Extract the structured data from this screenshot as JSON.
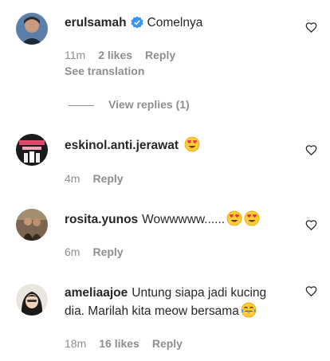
{
  "comments": [
    {
      "username": "erulsamah",
      "verified": true,
      "text": "Comelnya",
      "time": "11m",
      "likes": "2 likes",
      "reply_label": "Reply",
      "translation_label": "See translation",
      "view_replies_label": "View replies (1)"
    },
    {
      "username": "eskinol.anti.jerawat",
      "text": "",
      "emoji": "heart-eyes-emoji",
      "time": "4m",
      "reply_label": "Reply"
    },
    {
      "username": "rosita.yunos",
      "text": "Wowwwww......",
      "emoji": "heart-eyes-emoji x2",
      "time": "6m",
      "reply_label": "Reply"
    },
    {
      "username": "ameliaajoe",
      "text_line1": "Untung siapa jadi kucing",
      "text_line2": "dia. Marilah kita meow bersama",
      "emoji": "tears-of-joy-emoji",
      "time": "18m",
      "likes": "16 likes",
      "reply_label": "Reply"
    }
  ],
  "colors": {
    "text": "#262626",
    "secondary": "#8e8e8e",
    "verified": "#3897f0",
    "emoji": "#ffcc33",
    "heart_eyes": "#e8304a"
  }
}
